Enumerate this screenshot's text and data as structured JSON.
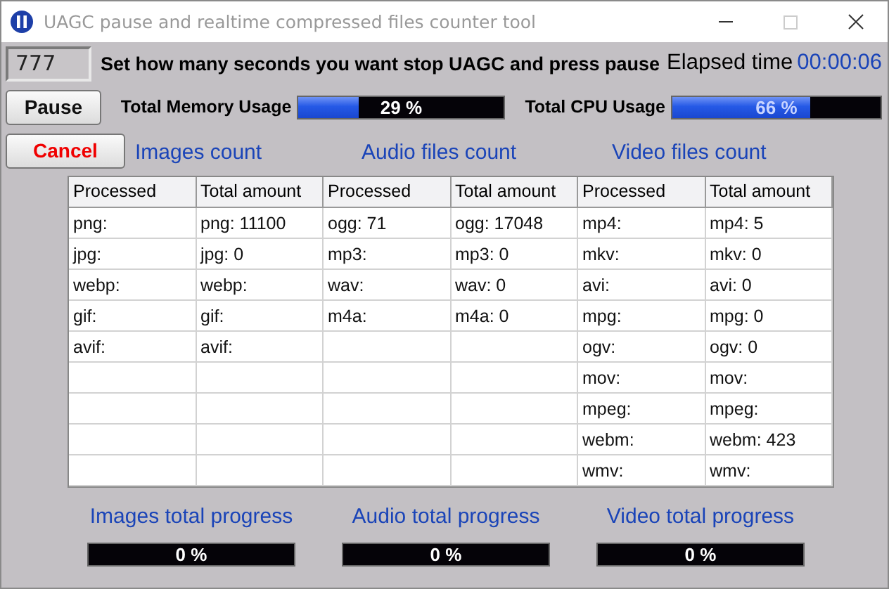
{
  "window": {
    "title": "UAGC pause and realtime compressed files counter tool"
  },
  "seconds_field": {
    "value": "777"
  },
  "instruction": "Set how many seconds you want stop UAGC and press pause",
  "elapsed": {
    "label": "Elapsed time",
    "value": "00:00:06"
  },
  "buttons": [
    {
      "label": "Pause",
      "kind": "normal"
    },
    {
      "label": "Cancel",
      "kind": "danger"
    }
  ],
  "meters": [
    {
      "label": "Total Memory Usage",
      "level": 0.29,
      "reading": "29 %"
    },
    {
      "label": "Total CPU Usage",
      "level": 0.66,
      "reading": "66 %"
    }
  ],
  "groups": [
    {
      "title": "Images count",
      "columns": [
        "Processed",
        "Total amount"
      ],
      "rows": [
        [
          "png:",
          "png: 11100"
        ],
        [
          "jpg:",
          "jpg: 0"
        ],
        [
          "webp:",
          "webp:"
        ],
        [
          "gif:",
          "gif:"
        ],
        [
          "avif:",
          "avif:"
        ]
      ],
      "progress": {
        "title": "Images total progress",
        "reading": "0 %"
      }
    },
    {
      "title": "Audio files count",
      "columns": [
        "Processed",
        "Total amount"
      ],
      "rows": [
        [
          "ogg: 71",
          "ogg: 17048"
        ],
        [
          "mp3:",
          "mp3: 0"
        ],
        [
          "wav:",
          "wav: 0"
        ],
        [
          "m4a:",
          "m4a: 0"
        ]
      ],
      "progress": {
        "title": "Audio total progress",
        "reading": "0 %"
      }
    },
    {
      "title": "Video files count",
      "columns": [
        "Processed",
        "Total amount"
      ],
      "rows": [
        [
          "mp4:",
          "mp4: 5"
        ],
        [
          "mkv:",
          "mkv: 0"
        ],
        [
          "avi:",
          "avi: 0"
        ],
        [
          "mpg:",
          "mpg: 0"
        ],
        [
          "ogv:",
          "ogv: 0"
        ],
        [
          "mov:",
          "mov:"
        ],
        [
          "mpeg:",
          "mpeg:"
        ],
        [
          "webm:",
          "webm: 423"
        ],
        [
          "wmv:",
          "wmv:"
        ]
      ],
      "progress": {
        "title": "Video total progress",
        "reading": "0 %"
      }
    }
  ]
}
